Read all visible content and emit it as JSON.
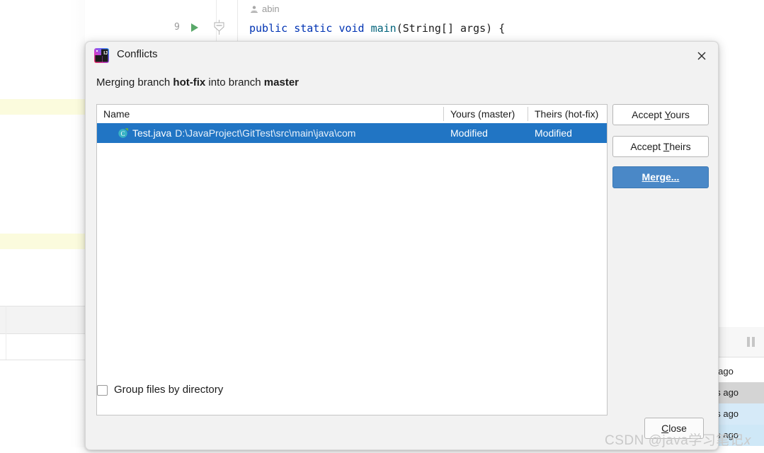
{
  "editor": {
    "line_number": "9",
    "author_hint": "abin",
    "code": {
      "kw_public": "public",
      "kw_static": "static",
      "kw_void": "void",
      "method": "main",
      "rest": "(String[] args) {"
    },
    "run_icon": "run-arrow-icon",
    "fold_icon": "code-fold-icon",
    "author_icon": "person-icon"
  },
  "log_panel": {
    "pause_icon": "pause-icon",
    "rows": [
      "s ago",
      "es ago",
      "es ago",
      "es ago"
    ]
  },
  "dialog": {
    "icon": "intellij-idea-icon",
    "title": "Conflicts",
    "close_icon": "close-icon",
    "subtitle": {
      "prefix": "Merging branch ",
      "source_branch": "hot-fix",
      "middle": " into branch ",
      "target_branch": "master"
    },
    "table": {
      "columns": [
        "Name",
        "Yours (master)",
        "Theirs (hot-fix)"
      ],
      "rows": [
        {
          "file_icon": "java-class-icon",
          "name": "Test.java",
          "path": "D:\\JavaProject\\GitTest\\src\\main\\java\\com",
          "yours": "Modified",
          "theirs": "Modified",
          "selected": true
        }
      ]
    },
    "buttons": {
      "accept_yours": "Accept Yours",
      "accept_yours_mnemonic": "Y",
      "accept_theirs": "Accept Theirs",
      "accept_theirs_mnemonic": "T",
      "merge": "Merge...",
      "close": "Close",
      "close_mnemonic": "C"
    },
    "checkbox": {
      "label": "Group files by directory",
      "checked": false
    }
  },
  "watermark": "CSDN @java学习笔记𝑥",
  "colors": {
    "selection_blue": "#2175c4",
    "merge_button": "#4a88c7",
    "run_green": "#59a869",
    "keyword_blue": "#0033b3",
    "method_teal": "#00627a",
    "highlight_yellow": "#fbfbdd"
  }
}
